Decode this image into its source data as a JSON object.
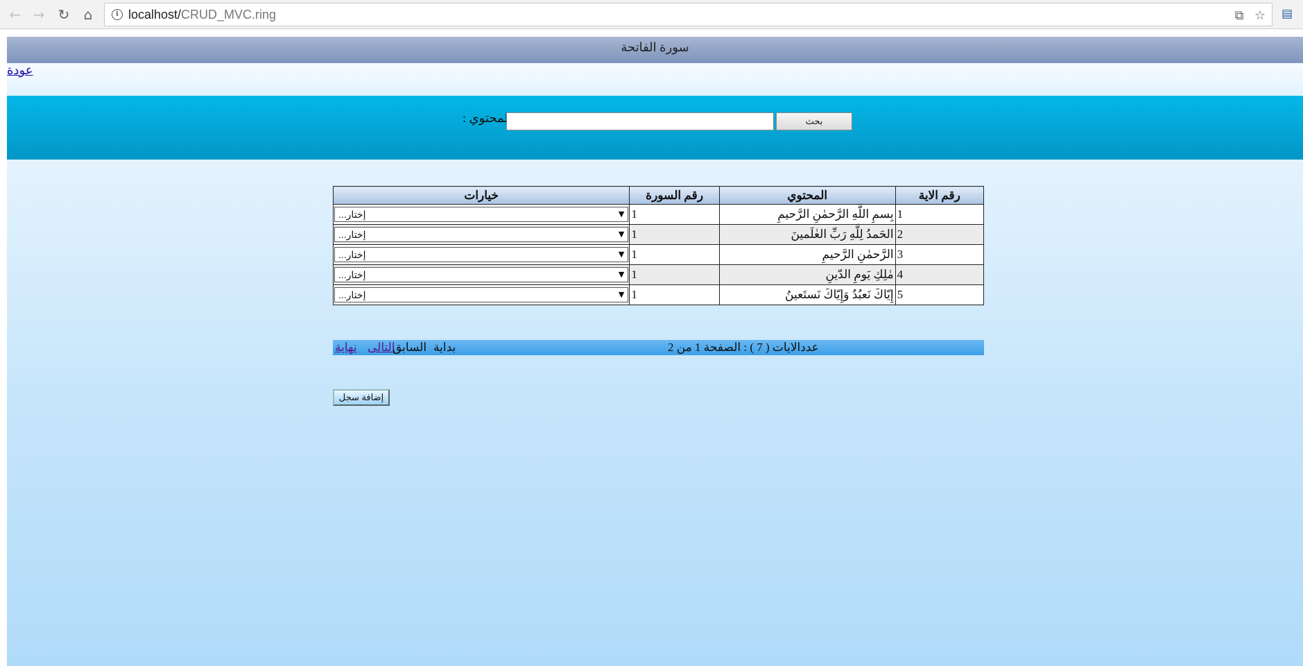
{
  "browser": {
    "url_host": "localhost/",
    "url_path": "CRUD_MVC.ring"
  },
  "page": {
    "title": "سورة الفاتحة",
    "back_link": "عودة",
    "search": {
      "label": ": المحتوي",
      "value": "",
      "button": "بحث"
    },
    "table": {
      "headers": {
        "options": "خيارات",
        "sura": "رقم السورة",
        "content": "المحتوي",
        "aya": "رقم الاية"
      },
      "rows": [
        {
          "aya": "1",
          "content": "بِسمِ اللَّهِ الرَّحمٰنِ الرَّحيمِ",
          "sura": "1",
          "option": "...إختار"
        },
        {
          "aya": "2",
          "content": "الحَمدُ لِلَّهِ رَبِّ العٰلَمينَ",
          "sura": "1",
          "option": "...إختار"
        },
        {
          "aya": "3",
          "content": "الرَّحمٰنِ الرَّحيمِ",
          "sura": "1",
          "option": "...إختار"
        },
        {
          "aya": "4",
          "content": "مٰلِكِ يَومِ الدّينِ",
          "sura": "1",
          "option": "...إختار"
        },
        {
          "aya": "5",
          "content": "إِيّاكَ نَعبُدُ وَإِيّاكَ نَستَعينُ",
          "sura": "1",
          "option": "...إختار"
        }
      ]
    },
    "pager": {
      "info": "عددالايات ( 7 ) : الصفحة 1 من 2",
      "first": "بداية",
      "prev": "السابق",
      "next": "التالى",
      "last": "نهاية"
    },
    "add_button": "إضافة سجل"
  }
}
